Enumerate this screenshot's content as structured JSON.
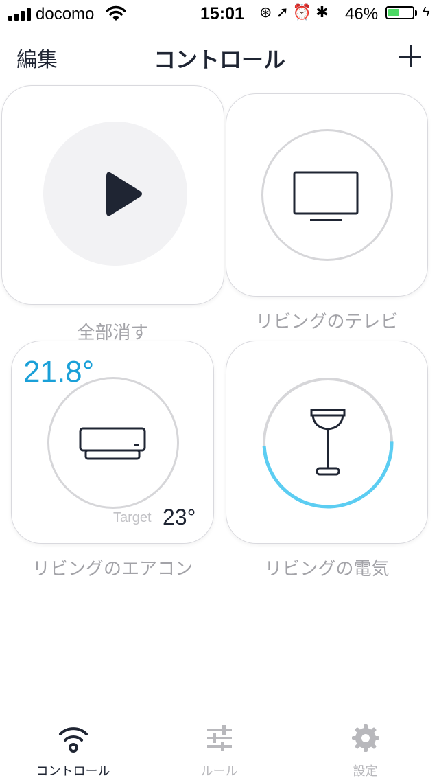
{
  "status_bar": {
    "carrier": "docomo",
    "time": "15:01",
    "battery_percent": "46%",
    "battery_level": 0.46,
    "icons": [
      "signal-icon",
      "wifi-icon",
      "orientation-lock-icon",
      "location-icon",
      "alarm-icon",
      "bluetooth-icon",
      "battery-icon",
      "charging-icon"
    ]
  },
  "nav": {
    "edit_label": "編集",
    "title": "コントロール",
    "add_icon": "plus-icon"
  },
  "tiles": [
    {
      "label": "全部消す",
      "icon": "play-icon"
    },
    {
      "label": "リビングのテレビ",
      "icon": "tv-icon"
    },
    {
      "label": "リビングのエアコン",
      "icon": "air-conditioner-icon",
      "current_temp": "21.8°",
      "target_label": "Target",
      "target_temp": "23°"
    },
    {
      "label": "リビングの電気",
      "icon": "floor-lamp-icon",
      "level": 0.5
    }
  ],
  "tab_bar": {
    "tabs": [
      {
        "label": "コントロール",
        "icon": "wifi-signal-icon",
        "active": true
      },
      {
        "label": "ルール",
        "icon": "sliders-icon",
        "active": false
      },
      {
        "label": "設定",
        "icon": "gear-icon",
        "active": false
      }
    ]
  },
  "colors": {
    "text_dark": "#1f2533",
    "label_gray": "#a3a3a8",
    "temp_blue": "#1aa0d8",
    "lamp_arc": "#5ccdf2",
    "ring_gray": "#d6d6d9",
    "battery_green": "#4cd964"
  }
}
